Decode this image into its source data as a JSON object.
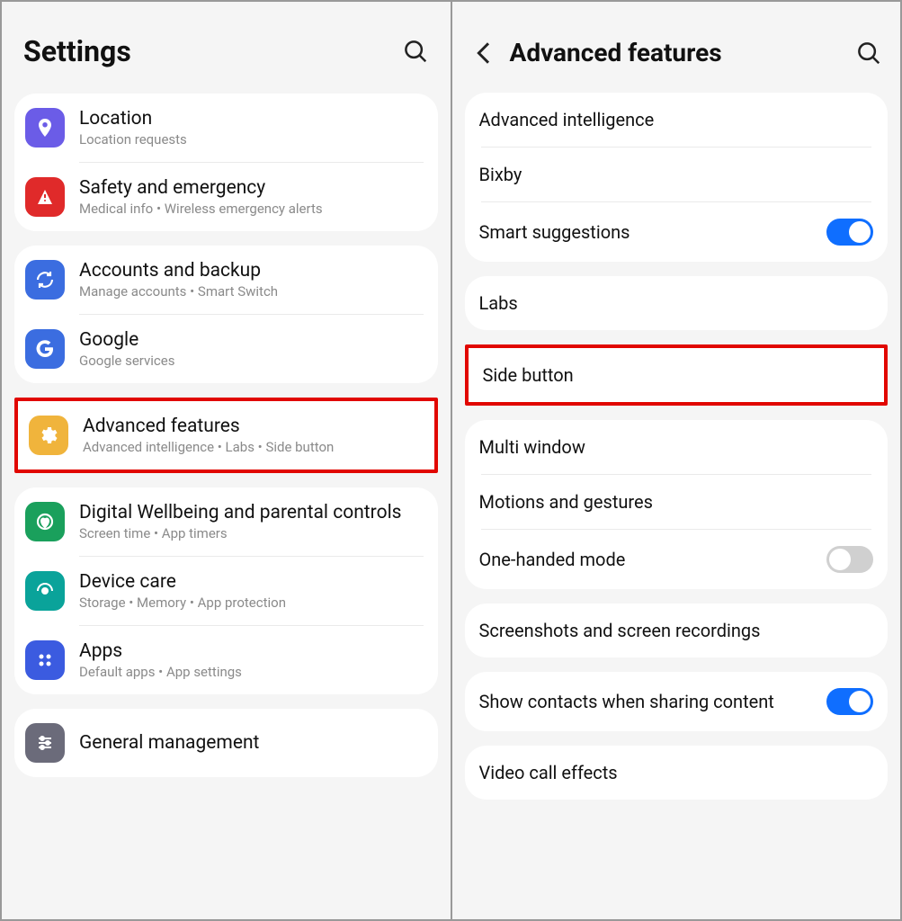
{
  "left": {
    "title": "Settings",
    "groups": [
      {
        "items": [
          {
            "icon": "location",
            "bg": "#6b5ce7",
            "title": "Location",
            "sub": "Location requests"
          },
          {
            "icon": "safety",
            "bg": "#e02a2a",
            "title": "Safety and emergency",
            "sub": "Medical info  •  Wireless emergency alerts"
          }
        ]
      },
      {
        "items": [
          {
            "icon": "accounts",
            "bg": "#3b6de0",
            "title": "Accounts and backup",
            "sub": "Manage accounts  •  Smart Switch"
          },
          {
            "icon": "google",
            "bg": "#3b6de0",
            "title": "Google",
            "sub": "Google services"
          }
        ]
      },
      {
        "highlight": true,
        "items": [
          {
            "icon": "advanced",
            "bg": "#f0b43c",
            "title": "Advanced features",
            "sub": "Advanced intelligence  •  Labs  •  Side button"
          }
        ]
      },
      {
        "items": [
          {
            "icon": "wellbeing",
            "bg": "#1aa05c",
            "title": "Digital Wellbeing and parental controls",
            "sub": "Screen time  •  App timers"
          },
          {
            "icon": "device",
            "bg": "#0aa39a",
            "title": "Device care",
            "sub": "Storage  •  Memory  •  App protection"
          },
          {
            "icon": "apps",
            "bg": "#3b5be0",
            "title": "Apps",
            "sub": "Default apps  •  App settings"
          }
        ]
      },
      {
        "items": [
          {
            "icon": "general",
            "bg": "#6b6b7a",
            "title": "General management",
            "sub": ""
          }
        ]
      }
    ]
  },
  "right": {
    "title": "Advanced features",
    "groups": [
      {
        "items": [
          {
            "title": "Advanced intelligence"
          },
          {
            "title": "Bixby"
          },
          {
            "title": "Smart suggestions",
            "toggle": "on"
          }
        ]
      },
      {
        "items": [
          {
            "title": "Labs"
          }
        ]
      },
      {
        "highlight": true,
        "items": [
          {
            "title": "Side button"
          }
        ]
      },
      {
        "items": [
          {
            "title": "Multi window"
          },
          {
            "title": "Motions and gestures"
          },
          {
            "title": "One-handed mode",
            "toggle": "off"
          }
        ]
      },
      {
        "items": [
          {
            "title": "Screenshots and screen recordings"
          }
        ]
      },
      {
        "items": [
          {
            "title": "Show contacts when sharing content",
            "toggle": "on"
          }
        ]
      },
      {
        "items": [
          {
            "title": "Video call effects"
          }
        ]
      }
    ]
  }
}
